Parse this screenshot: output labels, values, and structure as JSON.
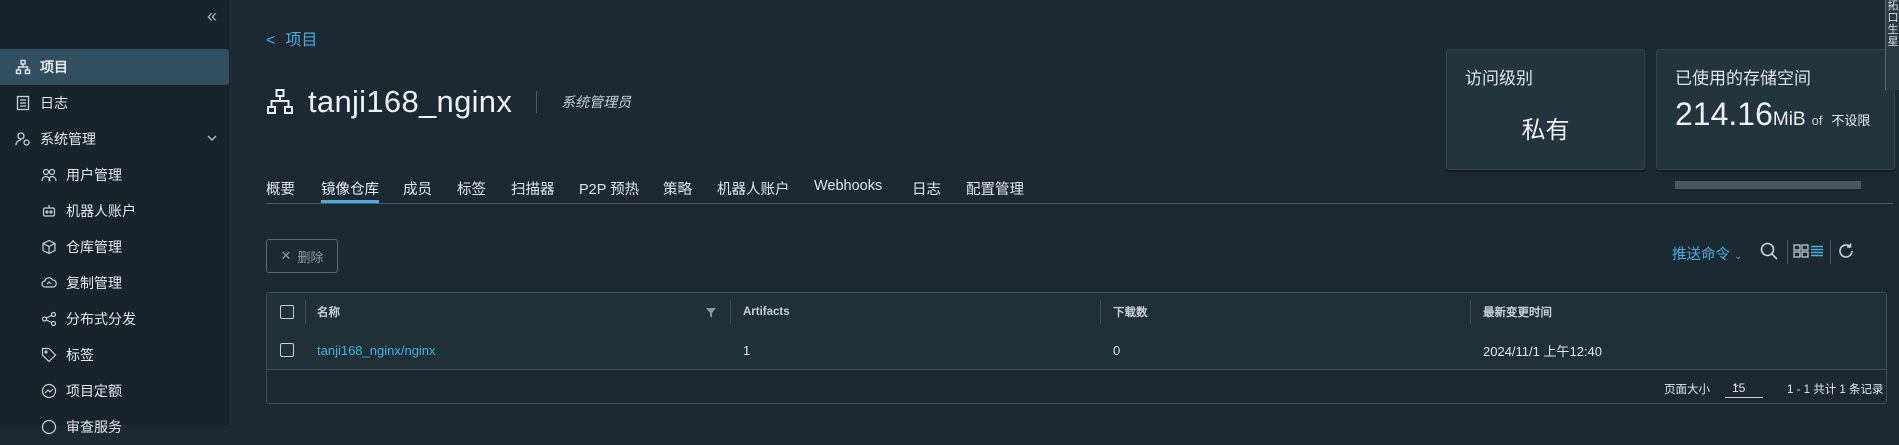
{
  "sidebar": {
    "items": [
      {
        "label": "项目",
        "icon": "projects-icon",
        "active": true
      },
      {
        "label": "日志",
        "icon": "logs-icon"
      },
      {
        "label": "系统管理",
        "icon": "admin-icon",
        "expanded": true
      },
      {
        "label": "用户管理",
        "icon": "users-icon"
      },
      {
        "label": "机器人账户",
        "icon": "robot-icon"
      },
      {
        "label": "仓库管理",
        "icon": "registry-icon"
      },
      {
        "label": "复制管理",
        "icon": "cloud-replication-icon"
      },
      {
        "label": "分布式分发",
        "icon": "share-icon"
      },
      {
        "label": "标签",
        "icon": "tag-icon"
      },
      {
        "label": "项目定额",
        "icon": "quota-icon"
      },
      {
        "label": "审查服务",
        "icon": "scanner-icon"
      }
    ]
  },
  "breadcrumb": {
    "label": "项目"
  },
  "project": {
    "name": "tanji168_nginx",
    "role": "系统管理员"
  },
  "cards": {
    "access": {
      "title": "访问级别",
      "value": "私有"
    },
    "storage": {
      "title": "已使用的存储空间",
      "value": "214.16",
      "unit": "MiB",
      "of": "of",
      "limit": "不设限",
      "usage_fraction": 0
    }
  },
  "tabs": [
    "概要",
    "镜像仓库",
    "成员",
    "标签",
    "扫描器",
    "P2P 预热",
    "策略",
    "机器人账户",
    "Webhooks",
    "日志",
    "配置管理"
  ],
  "active_tab": "镜像仓库",
  "toolbar": {
    "delete_label": "删除",
    "push_command": "推送命令"
  },
  "table": {
    "columns": [
      "名称",
      "Artifacts",
      "下载数",
      "最新变更时间"
    ],
    "rows": [
      {
        "name": "tanji168_nginx/nginx",
        "artifacts": "1",
        "pulls": "0",
        "updated": "2024/11/1 上午12:40"
      }
    ],
    "footer": {
      "page_size_label": "页面大小",
      "page_size": "15",
      "total": "1 - 1 共计 1 条记录"
    }
  },
  "right_strip": {
    "text": "拓\n口\n生\n星"
  },
  "colors": {
    "accent": "#49afd9",
    "background": "#1b2a32",
    "active_nav": "#324f62"
  }
}
